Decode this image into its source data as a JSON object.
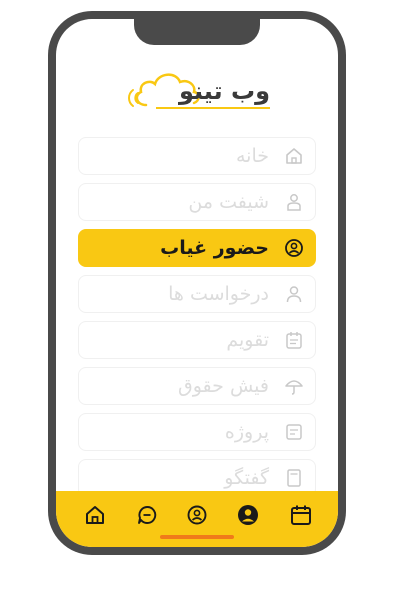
{
  "brand": {
    "name": "وب تینو"
  },
  "menu": {
    "items": [
      {
        "label": "خانه",
        "icon": "home-icon",
        "active": false
      },
      {
        "label": "شیفت من",
        "icon": "user-shift-icon",
        "active": false
      },
      {
        "label": "حضور غیاب",
        "icon": "face-id-icon",
        "active": true
      },
      {
        "label": "درخواست ها",
        "icon": "user-icon",
        "active": false
      },
      {
        "label": "تقویم",
        "icon": "calendar-icon",
        "active": false
      },
      {
        "label": "فیش حقوق",
        "icon": "umbrella-icon",
        "active": false
      },
      {
        "label": "پروژه",
        "icon": "project-icon",
        "active": false
      },
      {
        "label": "گفتگو",
        "icon": "chat-doc-icon",
        "active": false
      }
    ]
  },
  "bottom_nav": {
    "items": [
      {
        "icon": "home-icon"
      },
      {
        "icon": "chat-icon"
      },
      {
        "icon": "face-id-icon"
      },
      {
        "icon": "profile-icon"
      },
      {
        "icon": "calendar-icon"
      }
    ]
  },
  "colors": {
    "accent": "#f9c813",
    "frame": "#4a4a4a",
    "inactive_text": "#dcdcdc",
    "inactive_icon": "#c8c8c8",
    "home_indicator": "#f07a1a"
  }
}
